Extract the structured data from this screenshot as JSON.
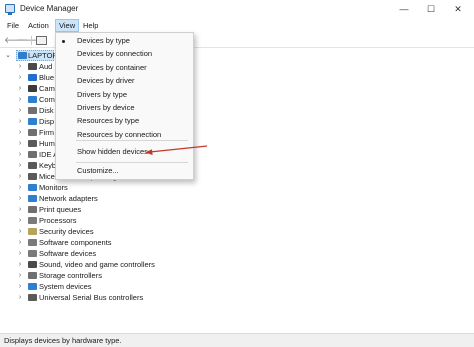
{
  "window": {
    "title": "Device Manager",
    "controls": {
      "minimize": "—",
      "maximize": "☐",
      "close": "✕"
    }
  },
  "menubar": [
    "File",
    "Action",
    "View",
    "Help"
  ],
  "toolbar": {
    "back": "🡐",
    "forward": "🡒"
  },
  "tree": {
    "root_label": "LAPTOP",
    "items": [
      {
        "label": "Aud",
        "icon": "audio-icon",
        "color": "#4a4a4a"
      },
      {
        "label": "Blue",
        "icon": "bluetooth-icon",
        "color": "#1f6fd1"
      },
      {
        "label": "Cam",
        "icon": "camera-icon",
        "color": "#3b3b3b"
      },
      {
        "label": "Com",
        "icon": "computer-icon",
        "color": "#2f7fd0"
      },
      {
        "label": "Disk",
        "icon": "disk-icon",
        "color": "#6f6f6f"
      },
      {
        "label": "Disp",
        "icon": "display-icon",
        "color": "#2f7fd0"
      },
      {
        "label": "Firm",
        "icon": "firmware-icon",
        "color": "#6f6f6f"
      },
      {
        "label": "Hum",
        "icon": "hid-icon",
        "color": "#5a5a5a"
      },
      {
        "label": "IDE A",
        "icon": "ide-icon",
        "color": "#6f6f6f"
      },
      {
        "label": "Keyb",
        "icon": "keyboard-icon",
        "color": "#5a5a5a"
      },
      {
        "label": "Mice and other pointing devices",
        "icon": "mouse-icon",
        "color": "#5a5a5a"
      },
      {
        "label": "Monitors",
        "icon": "monitor-icon",
        "color": "#2f7fd0"
      },
      {
        "label": "Network adapters",
        "icon": "network-icon",
        "color": "#2f7fd0"
      },
      {
        "label": "Print queues",
        "icon": "printer-icon",
        "color": "#6f6f6f"
      },
      {
        "label": "Processors",
        "icon": "processor-icon",
        "color": "#7a7a7a"
      },
      {
        "label": "Security devices",
        "icon": "security-icon",
        "color": "#b8a35a"
      },
      {
        "label": "Software components",
        "icon": "software-component-icon",
        "color": "#7a7a7a"
      },
      {
        "label": "Software devices",
        "icon": "software-device-icon",
        "color": "#7a7a7a"
      },
      {
        "label": "Sound, video and game controllers",
        "icon": "sound-icon",
        "color": "#4a4a4a"
      },
      {
        "label": "Storage controllers",
        "icon": "storage-icon",
        "color": "#6f6f6f"
      },
      {
        "label": "System devices",
        "icon": "system-icon",
        "color": "#2f7fd0"
      },
      {
        "label": "Universal Serial Bus controllers",
        "icon": "usb-icon",
        "color": "#5a5a5a"
      }
    ]
  },
  "view_menu": {
    "items": [
      {
        "label": "Devices by type",
        "checked": true
      },
      {
        "label": "Devices by connection",
        "checked": false
      },
      {
        "label": "Devices by container",
        "checked": false
      },
      {
        "label": "Devices by driver",
        "checked": false
      },
      {
        "label": "Drivers by type",
        "checked": false
      },
      {
        "label": "Drivers by device",
        "checked": false
      },
      {
        "label": "Resources by type",
        "checked": false
      },
      {
        "label": "Resources by connection",
        "checked": false
      }
    ],
    "show_hidden": "Show hidden devices",
    "customize": "Customize..."
  },
  "annotation_color": "#c0392b",
  "status": "Displays devices by hardware type."
}
